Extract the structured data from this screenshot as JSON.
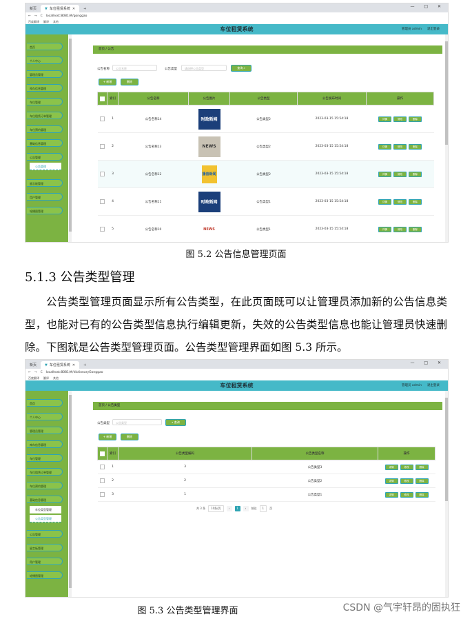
{
  "browser": {
    "tab1": "新标签页",
    "tab2": "车位租赁系统",
    "tab1_b": "新页",
    "url1": "localhost:8081/#/gonggao",
    "url2": "localhost:8081/#/dictionaryGonggao",
    "bookmarks": [
      "百度翻译",
      "翻译",
      "其他"
    ],
    "window_controls": "— □ ✕"
  },
  "app": {
    "title": "车位租赁系统",
    "user": "管理员 admin",
    "logout": "退出登录"
  },
  "fig1": {
    "sidebar": [
      "首页",
      "个人中心",
      "管理员管理",
      "库存信息管理",
      "车位管理",
      "车位租赁订单管理",
      "车位预约管理",
      "基础信息管理",
      "公告管理"
    ],
    "sidebar_sub": "公告管理",
    "sidebar_after": [
      "留言板管理",
      "用户管理",
      "轮播图管理"
    ],
    "breadcrumb": "首页 / 公告",
    "filter1_label": "公告名称",
    "filter1_ph": "公告名称",
    "filter2_label": "公告类型",
    "filter2_ph": "请选择公告类型",
    "search_btn": "查询",
    "add_btn": "+ 新增",
    "del_btn": "删除",
    "headers": [
      "索引",
      "公告名称",
      "公告图片",
      "公告类型",
      "公告发布时间",
      "操作"
    ],
    "rows": [
      {
        "idx": "1",
        "name": "公告名称14",
        "img": "时政新闻",
        "type": "公告类型2",
        "time": "2023-03-15 15:54:18"
      },
      {
        "idx": "2",
        "name": "公告名称13",
        "img": "NEWS",
        "type": "公告类型2",
        "time": "2023-03-15 15:54:18"
      },
      {
        "idx": "3",
        "name": "公告名称12",
        "img": "播音新闻",
        "type": "公告类型2",
        "time": "2023-03-15 15:54:18"
      },
      {
        "idx": "4",
        "name": "公告名称11",
        "img": "时政新闻",
        "type": "公告类型1",
        "time": "2023-03-15 15:54:18"
      },
      {
        "idx": "5",
        "name": "公告名称10",
        "img": "NEWS",
        "type": "公告类型1",
        "time": "2023-03-15 15:54:18"
      }
    ],
    "ops": [
      "详情",
      "修改",
      "删除"
    ],
    "caption": "图 5.2  公告信息管理页面"
  },
  "section": {
    "heading": "5.1.3  公告类型管理",
    "paragraph": "公告类型管理页面显示所有公告类型，在此页面既可以让管理员添加新的公告信息类型，也能对已有的公告类型信息执行编辑更新，失效的公告类型信息也能让管理员快速删除。下图就是公告类型管理页面。公告类型管理界面如图 5.3 所示。"
  },
  "fig2": {
    "sidebar": [
      "首页",
      "个人中心",
      "管理员管理",
      "库存信息管理",
      "车位管理",
      "车位租赁订单管理",
      "车位预约管理",
      "基础信息管理"
    ],
    "sidebar_subs": [
      "车位类型管理",
      "公告类型管理"
    ],
    "sidebar_after": [
      "公告管理",
      "留言板管理",
      "用户管理",
      "轮播图管理"
    ],
    "breadcrumb": "首页 / 公告类型",
    "filter_label": "公告类型",
    "filter_ph": "公告类型",
    "search_btn": "查询",
    "add_btn": "+ 新增",
    "del_btn": "删除",
    "headers": [
      "索引",
      "公告类型编码",
      "公告类型名称",
      "操作"
    ],
    "rows": [
      {
        "idx": "1",
        "code": "3",
        "name": "公告类型3"
      },
      {
        "idx": "2",
        "code": "2",
        "name": "公告类型2"
      },
      {
        "idx": "3",
        "code": "1",
        "name": "公告类型1"
      }
    ],
    "ops": [
      "详情",
      "修改",
      "删除"
    ],
    "pager": {
      "total": "共 3 条",
      "size": "10条/页",
      "page": "1",
      "goto": "前往",
      "goto_val": "1",
      "unit": "页"
    },
    "caption": "图 5.3 公告类型管理界面"
  },
  "watermark": "CSDN @气宇轩昂的固执狂"
}
